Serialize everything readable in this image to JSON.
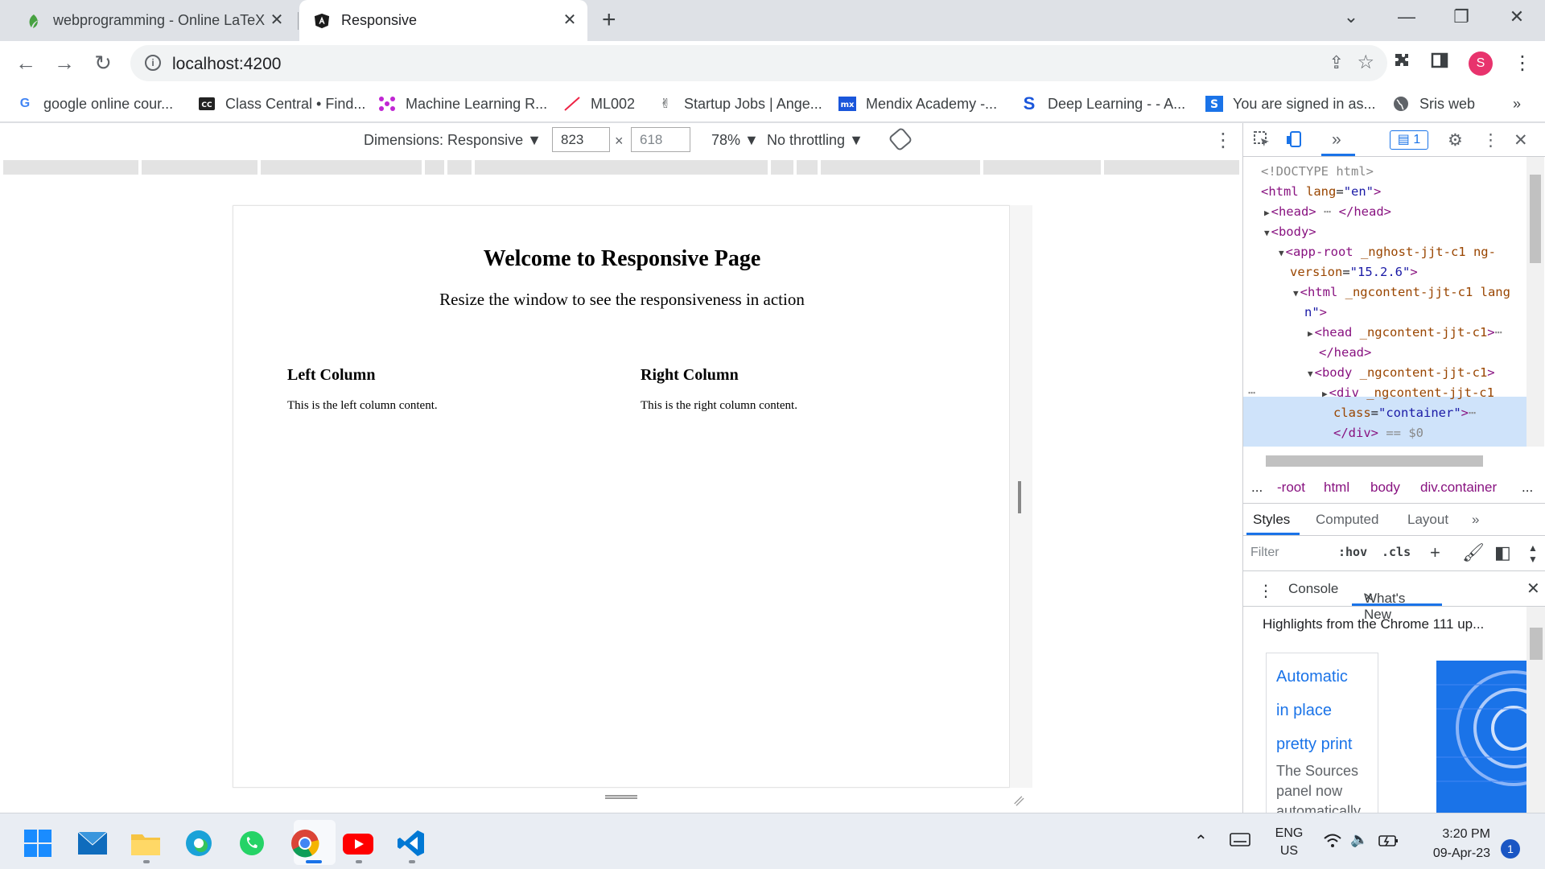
{
  "browser": {
    "tabs": [
      {
        "title": "webprogramming - Online LaTeX",
        "favicon": "overleaf-leaf-icon",
        "active": false
      },
      {
        "title": "Responsive",
        "favicon": "angular-icon",
        "active": true
      }
    ],
    "new_tab_symbol": "+",
    "url": "localhost:4200",
    "profile_initial": "S",
    "bookmarks": [
      {
        "label": "google online cour...",
        "icon": "google-icon"
      },
      {
        "label": "Class Central • Find...",
        "icon": "class-central-icon"
      },
      {
        "label": "Machine Learning R...",
        "icon": "ml-icon"
      },
      {
        "label": "ML002",
        "icon": "pen-icon"
      },
      {
        "label": "Startup Jobs | Ange...",
        "icon": "angellist-icon"
      },
      {
        "label": "Mendix Academy -...",
        "icon": "mendix-icon"
      },
      {
        "label": "Deep Learning - - A...",
        "icon": "deep-learning-icon"
      },
      {
        "label": "You are signed in as...",
        "icon": "s-icon"
      },
      {
        "label": "Sris web",
        "icon": "globe-icon"
      }
    ],
    "bookmark_overflow": "»"
  },
  "device_toolbar": {
    "dimensions_label": "Dimensions: Responsive",
    "width": "823",
    "height": "618",
    "times": "×",
    "zoom": "78%",
    "throttling": "No throttling"
  },
  "page": {
    "heading": "Welcome to Responsive Page",
    "subheading": "Resize the window to see the responsiveness in action",
    "left_title": "Left Column",
    "left_text": "This is the left column content.",
    "right_title": "Right Column",
    "right_text": "This is the right column content."
  },
  "devtools": {
    "issues_count": "1",
    "more_tabs": "»",
    "breadcrumbs": [
      "...",
      "-root",
      "html",
      "body",
      "div.container",
      "..."
    ],
    "panel_tabs": [
      "Styles",
      "Computed",
      "Layout",
      "»"
    ],
    "filter_placeholder": "Filter",
    "hov": ":hov",
    "cls": ".cls",
    "drawer_tabs": [
      "Console",
      "What's New"
    ],
    "highlights": "Highlights from the Chrome 111 up...",
    "card_links": [
      "Automatic",
      "in place",
      "pretty print"
    ],
    "card_text": "The Sources panel now automatically"
  },
  "taskbar": {
    "lang": "ENG",
    "region": "US",
    "time": "3:20 PM",
    "date": "09-Apr-23",
    "notifications": "1"
  },
  "colors": {
    "accent": "#1a73e8",
    "selection": "#cfe3fa",
    "profile": "#e8336d"
  }
}
